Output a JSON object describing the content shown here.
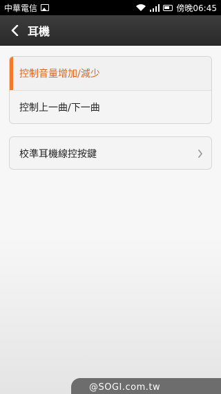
{
  "status_bar": {
    "carrier": "中華電信",
    "time": "傍晚06:45",
    "icons": [
      "gallery-icon",
      "wifi-icon",
      "signal-icon",
      "battery-icon"
    ]
  },
  "header": {
    "title": "耳機",
    "back_icon": "chevron-left-icon"
  },
  "options": [
    {
      "label": "控制音量增加/減少",
      "selected": true
    },
    {
      "label": "控制上一曲/下一曲",
      "selected": false
    }
  ],
  "calibrate": {
    "label": "校準耳機線控按鍵",
    "icon": "chevron-right-icon"
  },
  "watermark": "@SOGI.com.tw",
  "colors": {
    "accent": "#f47a28",
    "selected_text": "#e1661c",
    "title_bar": "#333333"
  }
}
